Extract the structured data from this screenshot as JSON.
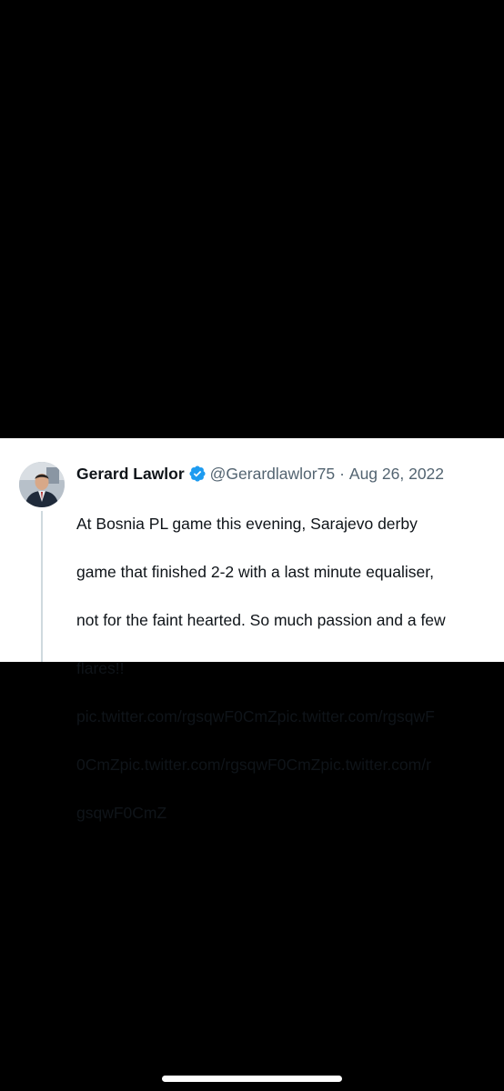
{
  "tweet": {
    "author_name": "Gerard Lawlor",
    "verified": true,
    "verified_icon": "verified-badge-icon",
    "handle": "@Gerardlawlor75",
    "separator": "·",
    "date": "Aug 26, 2022",
    "text_lines": [
      "At Bosnia PL game this evening, Sarajevo derby",
      "game that finished 2-2 with a last minute equaliser,",
      "not for the faint hearted. So much passion and a few",
      "flares!!",
      "pic.twitter.com/rgsqwF0CmZpic.twitter.com/rgsqwF",
      "0CmZpic.twitter.com/rgsqwF0CmZpic.twitter.com/r",
      "gsqwF0CmZ"
    ]
  },
  "colors": {
    "background": "#000000",
    "card": "#ffffff",
    "text_primary": "#0f1419",
    "text_secondary": "#536471",
    "verified_blue": "#1d9bf0",
    "thread_line": "#cfd9de"
  }
}
